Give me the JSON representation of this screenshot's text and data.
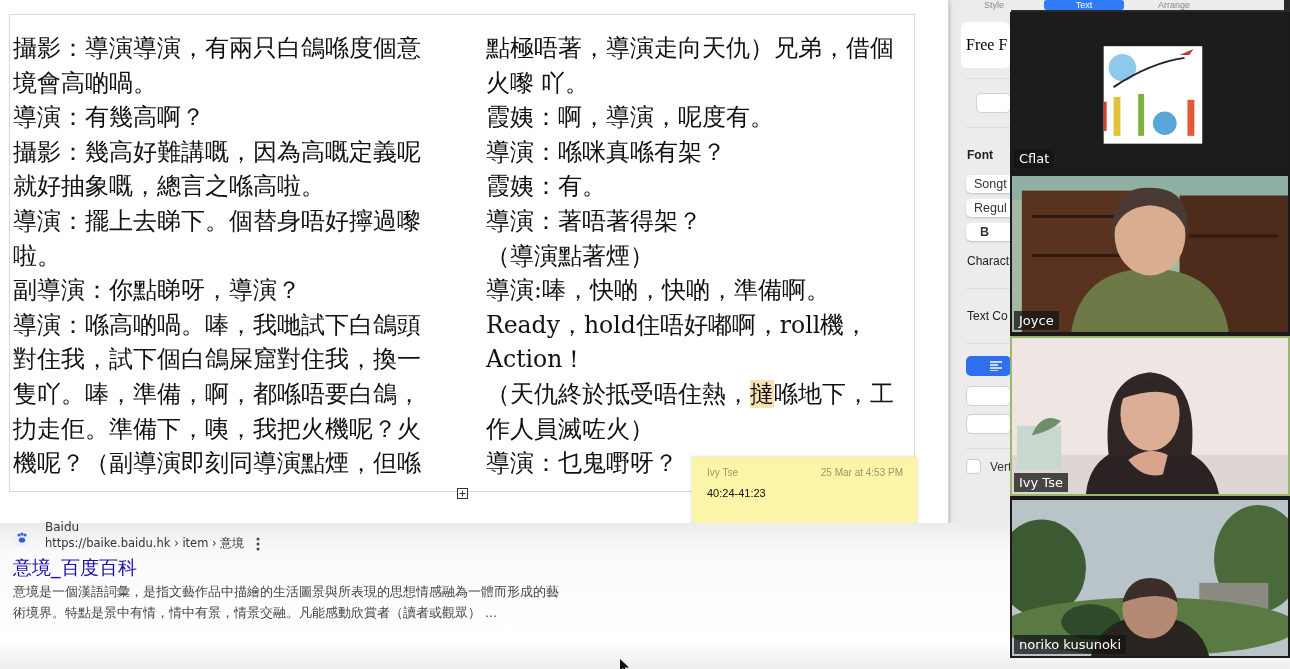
{
  "document": {
    "left_lines": [
      {
        "text": "攝影：導演導演，有兩只白鴿喺度個意"
      },
      {
        "text": "境會高啲喎。"
      },
      {
        "text": "導演：有幾高啊？"
      },
      {
        "text": "攝影：幾高好難講嘅，因為高嘅定義呢"
      },
      {
        "text": "就好抽象嘅，總言之喺高啦。"
      },
      {
        "text": "導演：擺上去睇下。個替身唔好擰過嚟"
      },
      {
        "text": "啦。"
      },
      {
        "text": "副導演：你點睇呀，導演？"
      },
      {
        "text": "導演：喺高啲喎。唪，我哋試下白鴿頭"
      },
      {
        "text": "對住我，試下個白鴿屎窟對住我，換一"
      },
      {
        "text": "隻吖。唪，準備，啊，都喺唔要白鴿，"
      },
      {
        "text": "扐走佢。準備下，咦，我把火機呢？火"
      },
      {
        "text": "機呢？（副導演即刻同導演點煙，但喺"
      }
    ],
    "right_lines": [
      {
        "text": "點極唔著，導演走向天仇）兄弟，借個"
      },
      {
        "text": "火嚟 吖。"
      },
      {
        "text": "霞姨：啊，導演，呢度有。"
      },
      {
        "text": "導演：喺咪真喺有架？"
      },
      {
        "text": "霞姨：有。"
      },
      {
        "text": "導演：著唔著得架？"
      },
      {
        "text": "（導演點著煙）"
      },
      {
        "text": "導演:唪，快啲，快啲，準備啊。"
      },
      {
        "text": "Ready，hold住唔好嘟啊，roll機，"
      },
      {
        "text": "Action！"
      },
      {
        "segments": [
          {
            "text": "（天仇終於抵受唔住熱，",
            "highlighted": false
          },
          {
            "text": "撻",
            "highlighted": true
          },
          {
            "text": "喺地下，工",
            "highlighted": false
          }
        ]
      },
      {
        "text": "作人員滅咗火）"
      },
      {
        "text": "導演：乜鬼嘢呀？"
      }
    ]
  },
  "comment": {
    "author": "Ivy Tse",
    "time": "25 Mar at 4:53 PM",
    "body": "40:24-41:23"
  },
  "sidebar": {
    "tabs": [
      {
        "label": "Style",
        "selected": false
      },
      {
        "label": "Text",
        "selected": true
      },
      {
        "label": "Arrange",
        "selected": false
      }
    ],
    "font_preview": "Free F",
    "font_label": "Font",
    "font_family": "Songt",
    "font_style": "Regul",
    "bold_button": "B",
    "character_label": "Charact",
    "text_color_label": "Text Co",
    "vertical": {
      "label": "Vert",
      "checked": false
    }
  },
  "video_tiles": [
    {
      "name": "Cflat",
      "kind": "logo",
      "speaking": false
    },
    {
      "name": "Joyce",
      "kind": "room",
      "speaking": false
    },
    {
      "name": "Ivy Tse",
      "kind": "wall",
      "speaking": true
    },
    {
      "name": "noriko kusunoki",
      "kind": "garden",
      "speaking": false
    }
  ],
  "search_result": {
    "site": "Baidu",
    "url": "https://baike.baidu.hk › item › 意境",
    "title": "意境_百度百科",
    "snippet_lines": [
      "意境是一個漢語詞彙，是指文藝作品中描繪的生活圖景與所表現的思想情感融為一體而形成的藝",
      "術境界。特點是景中有情，情中有景，情景交融。凡能感動欣賞者（讀者或觀眾） ..."
    ]
  }
}
